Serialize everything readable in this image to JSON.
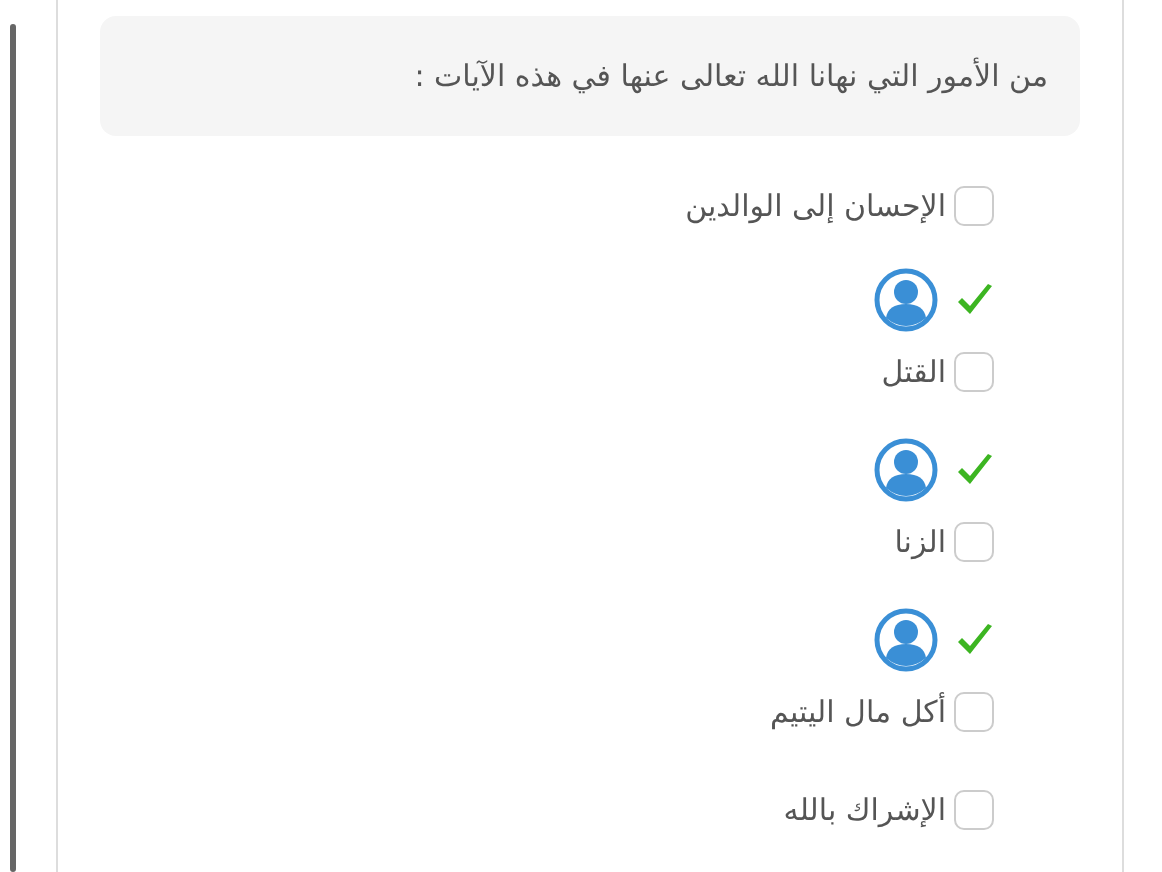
{
  "question": "من الأمور التي نهانا الله تعالى عنها في هذه الآيات :",
  "options": [
    {
      "label": "الإحسان إلى الوالدين",
      "checked": false,
      "marked": false
    },
    {
      "label": "القتل",
      "checked": false,
      "marked": true
    },
    {
      "label": "الزنا",
      "checked": false,
      "marked": true
    },
    {
      "label": "أكل مال اليتيم",
      "checked": false,
      "marked": true
    },
    {
      "label": "الإشراك بالله",
      "checked": false,
      "marked": false
    }
  ]
}
